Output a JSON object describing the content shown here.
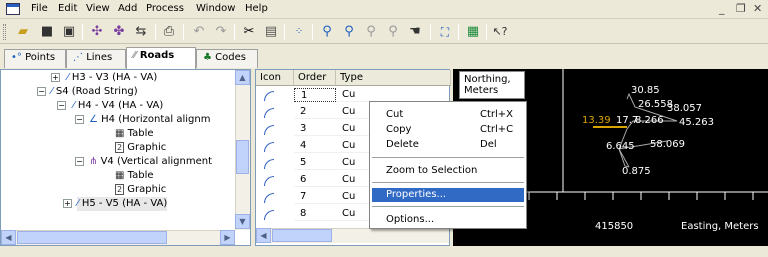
{
  "menubar": {
    "items": [
      "File",
      "Edit",
      "View",
      "Add",
      "Process",
      "Window",
      "Help"
    ],
    "window_controls": [
      "_",
      "❐",
      "✕"
    ]
  },
  "toolbar": {
    "icons": [
      "open-folder-icon",
      "save-icon",
      "save-all-icon",
      "icon-a",
      "icon-b",
      "icon-c",
      "print-icon",
      "undo-icon",
      "redo-icon",
      "cut-icon",
      "paste-icon",
      "point-icon",
      "zoom-in-icon",
      "zoom-out-icon",
      "zoom-window-icon",
      "zoom-prev-icon",
      "pan-icon",
      "zoom-extents-icon",
      "table-icon",
      "help-pointer-icon"
    ]
  },
  "tabs": [
    {
      "label": "Points",
      "icon": "points-tab-icon"
    },
    {
      "label": "Lines",
      "icon": "lines-tab-icon"
    },
    {
      "label": "Roads",
      "icon": "roads-tab-icon",
      "active": true
    },
    {
      "label": "Codes",
      "icon": "codes-tab-icon"
    }
  ],
  "tree": {
    "rows": [
      {
        "label": "H3 - V3 (HA - VA)",
        "expander": "+"
      },
      {
        "label": "S4 (Road String)",
        "expander": "-"
      },
      {
        "label": "H4 - V4 (HA - VA)",
        "expander": "-"
      },
      {
        "label": "H4 (Horizontal alignm",
        "expander": "-"
      },
      {
        "label": "Table"
      },
      {
        "label": "Graphic"
      },
      {
        "label": "V4 (Vertical alignment",
        "expander": "-"
      },
      {
        "label": "Table"
      },
      {
        "label": "Graphic"
      },
      {
        "label": "H5 - V5 (HA - VA)",
        "expander": "+"
      }
    ]
  },
  "grid": {
    "headers": [
      "Icon",
      "Order",
      "Type"
    ],
    "rows": [
      {
        "order": "1",
        "type": "Cu"
      },
      {
        "order": "2",
        "type": "Cu"
      },
      {
        "order": "3",
        "type": "Cu"
      },
      {
        "order": "4",
        "type": "Cu"
      },
      {
        "order": "5",
        "type": "Cu"
      },
      {
        "order": "6",
        "type": "Cu"
      },
      {
        "order": "7",
        "type": "Cu"
      },
      {
        "order": "8",
        "type": "Cu"
      }
    ]
  },
  "plot": {
    "ylabel_line1": "Northing,",
    "ylabel_line2": "Meters",
    "xlabel": "Easting, Meters",
    "x_tick_label": "415850",
    "labels": [
      "30.85",
      "26.558",
      "38.057",
      "13.39",
      "17.7",
      "8.266",
      "45.263",
      "6.645",
      "58.069",
      "0.875"
    ]
  },
  "context_menu": {
    "items": [
      {
        "label": "Cut",
        "shortcut": "Ctrl+X"
      },
      {
        "label": "Copy",
        "shortcut": "Ctrl+C"
      },
      {
        "label": "Delete",
        "shortcut": "Del"
      },
      {
        "label": "Zoom to Selection",
        "shortcut": ""
      },
      {
        "label": "Properties...",
        "shortcut": "",
        "highlighted": true
      },
      {
        "label": "Options...",
        "shortcut": ""
      }
    ]
  },
  "colors": {
    "accent": "#316ac5",
    "plot_bg": "#000000",
    "road_line": "#d9a400"
  }
}
